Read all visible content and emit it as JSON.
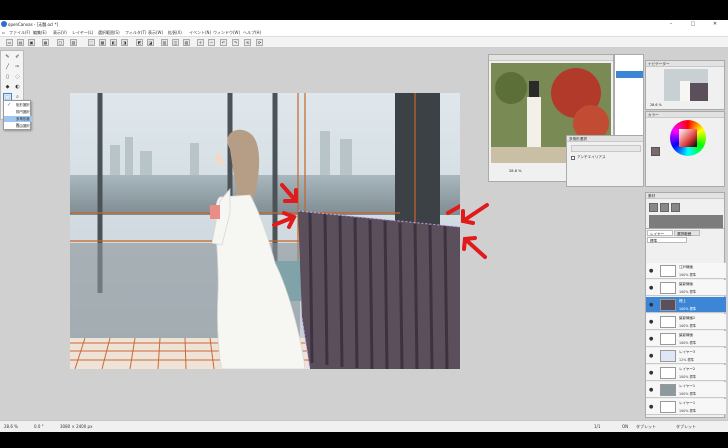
{
  "title": "openCanvas - [无題.ocl *]",
  "window_controls": [
    "–",
    "□",
    "✕"
  ],
  "menu": [
    "ファイル(F)",
    "編集(E)",
    "表示(V)",
    "レイヤー(L)",
    "選択範囲(S)",
    "フィルタ(T)",
    "表示(W)",
    "拡張(X)",
    "イベント(N)",
    "ウィンドウ(W)",
    "ヘルプ(H)"
  ],
  "toolbar_icons": [
    "new-icon",
    "open-icon",
    "save-icon",
    "print-icon",
    "copy-icon",
    "paste-icon",
    "select-icon",
    "deselect-icon",
    "invert-icon",
    "crop-icon",
    "rotate-icon",
    "flip-icon",
    "layer-icon",
    "blend-icon",
    "lock-icon",
    "zoom-in-icon",
    "zoom-out-icon",
    "undo-icon",
    "redo-icon",
    "fit-icon"
  ],
  "selection_menu": {
    "items": [
      "矩形選択",
      "楕円選択",
      "多角形選択",
      "自由選択"
    ],
    "selected_index": 2
  },
  "navigator": {
    "title": "ナビゲーター",
    "zoom": "28.6 %",
    "angle": "0.0 °"
  },
  "color_panel": {
    "title": "カラー",
    "accent": "#e03c3c"
  },
  "tool_option_panel": {
    "title": "多角形選択",
    "checkbox_label": "アンチエイリアス"
  },
  "material_panel": {
    "title": "素材"
  },
  "layer_panel": {
    "tabs": [
      "レイヤー",
      "選択範囲"
    ],
    "blend_label": "標準",
    "layers": [
      {
        "name": "江戸線画",
        "opacity": "100% 標準",
        "selected": false
      },
      {
        "name": "髪影線画",
        "opacity": "100% 標準",
        "selected": false
      },
      {
        "name": "柵上",
        "opacity": "100% 標準",
        "selected": true
      },
      {
        "name": "髪影線画2",
        "opacity": "100% 標準",
        "selected": false
      },
      {
        "name": "髪影線画",
        "opacity": "100% 標準",
        "selected": false
      },
      {
        "name": "レイヤー3",
        "opacity": "12% 標準",
        "selected": false
      },
      {
        "name": "レイヤー2",
        "opacity": "100% 標準",
        "selected": false
      },
      {
        "name": "レイヤー1",
        "opacity": "100% 標準",
        "selected": false
      },
      {
        "name": "レイヤー1",
        "opacity": "100% 標準",
        "selected": false
      }
    ]
  },
  "status": {
    "zoom": "28.6 %",
    "angle": "0.0 °",
    "size": "3080 × 2400 px",
    "page": "1/1",
    "mode": "タブレット",
    "mode2": "タブレット",
    "flag": "ON"
  }
}
